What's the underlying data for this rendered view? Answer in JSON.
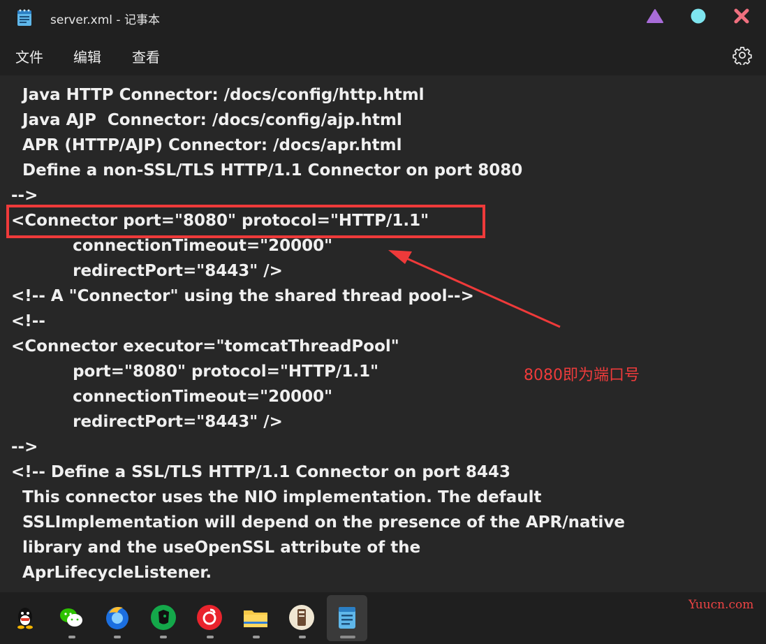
{
  "window": {
    "title": "server.xml - 记事本"
  },
  "menu": {
    "file": "文件",
    "edit": "编辑",
    "view": "查看"
  },
  "icons": {
    "app": "notepad-icon",
    "minimize": "triangle-icon",
    "maximize": "circle-icon",
    "close": "close-x-icon",
    "settings": "gear-icon"
  },
  "colors": {
    "accent_red": "#ef3a3a",
    "minimize_purple": "#a86cd8",
    "maximize_cyan": "#7ee5ef",
    "close_pink": "#f0707f"
  },
  "editor": {
    "lines": [
      "    Java HTTP Connector: /docs/config/http.html",
      "    Java AJP  Connector: /docs/config/ajp.html",
      "    APR (HTTP/AJP) Connector: /docs/apr.html",
      "    Define a non-SSL/TLS HTTP/1.1 Connector on port 8080",
      "  -->",
      "  <Connector port=\"8080\" protocol=\"HTTP/1.1\"",
      "             connectionTimeout=\"20000\"",
      "             redirectPort=\"8443\" />",
      "  <!-- A \"Connector\" using the shared thread pool-->",
      "  <!--",
      "  <Connector executor=\"tomcatThreadPool\"",
      "             port=\"8080\" protocol=\"HTTP/1.1\"",
      "             connectionTimeout=\"20000\"",
      "             redirectPort=\"8443\" />",
      "  -->",
      "  <!-- Define a SSL/TLS HTTP/1.1 Connector on port 8443",
      "    This connector uses the NIO implementation. The default",
      "    SSLImplementation will depend on the presence of the APR/native",
      "    library and the useOpenSSL attribute of the",
      "    AprLifecycleListener."
    ]
  },
  "annotation": {
    "text": "8080即为端口号"
  },
  "taskbar": {
    "apps": [
      "qq-icon",
      "wechat-icon",
      "firefox-icon",
      "evernote-icon",
      "netease-music-icon",
      "file-explorer-icon",
      "reader-app-icon",
      "notepad-icon"
    ],
    "active": "notepad-icon"
  },
  "watermark": "Yuucn.com"
}
